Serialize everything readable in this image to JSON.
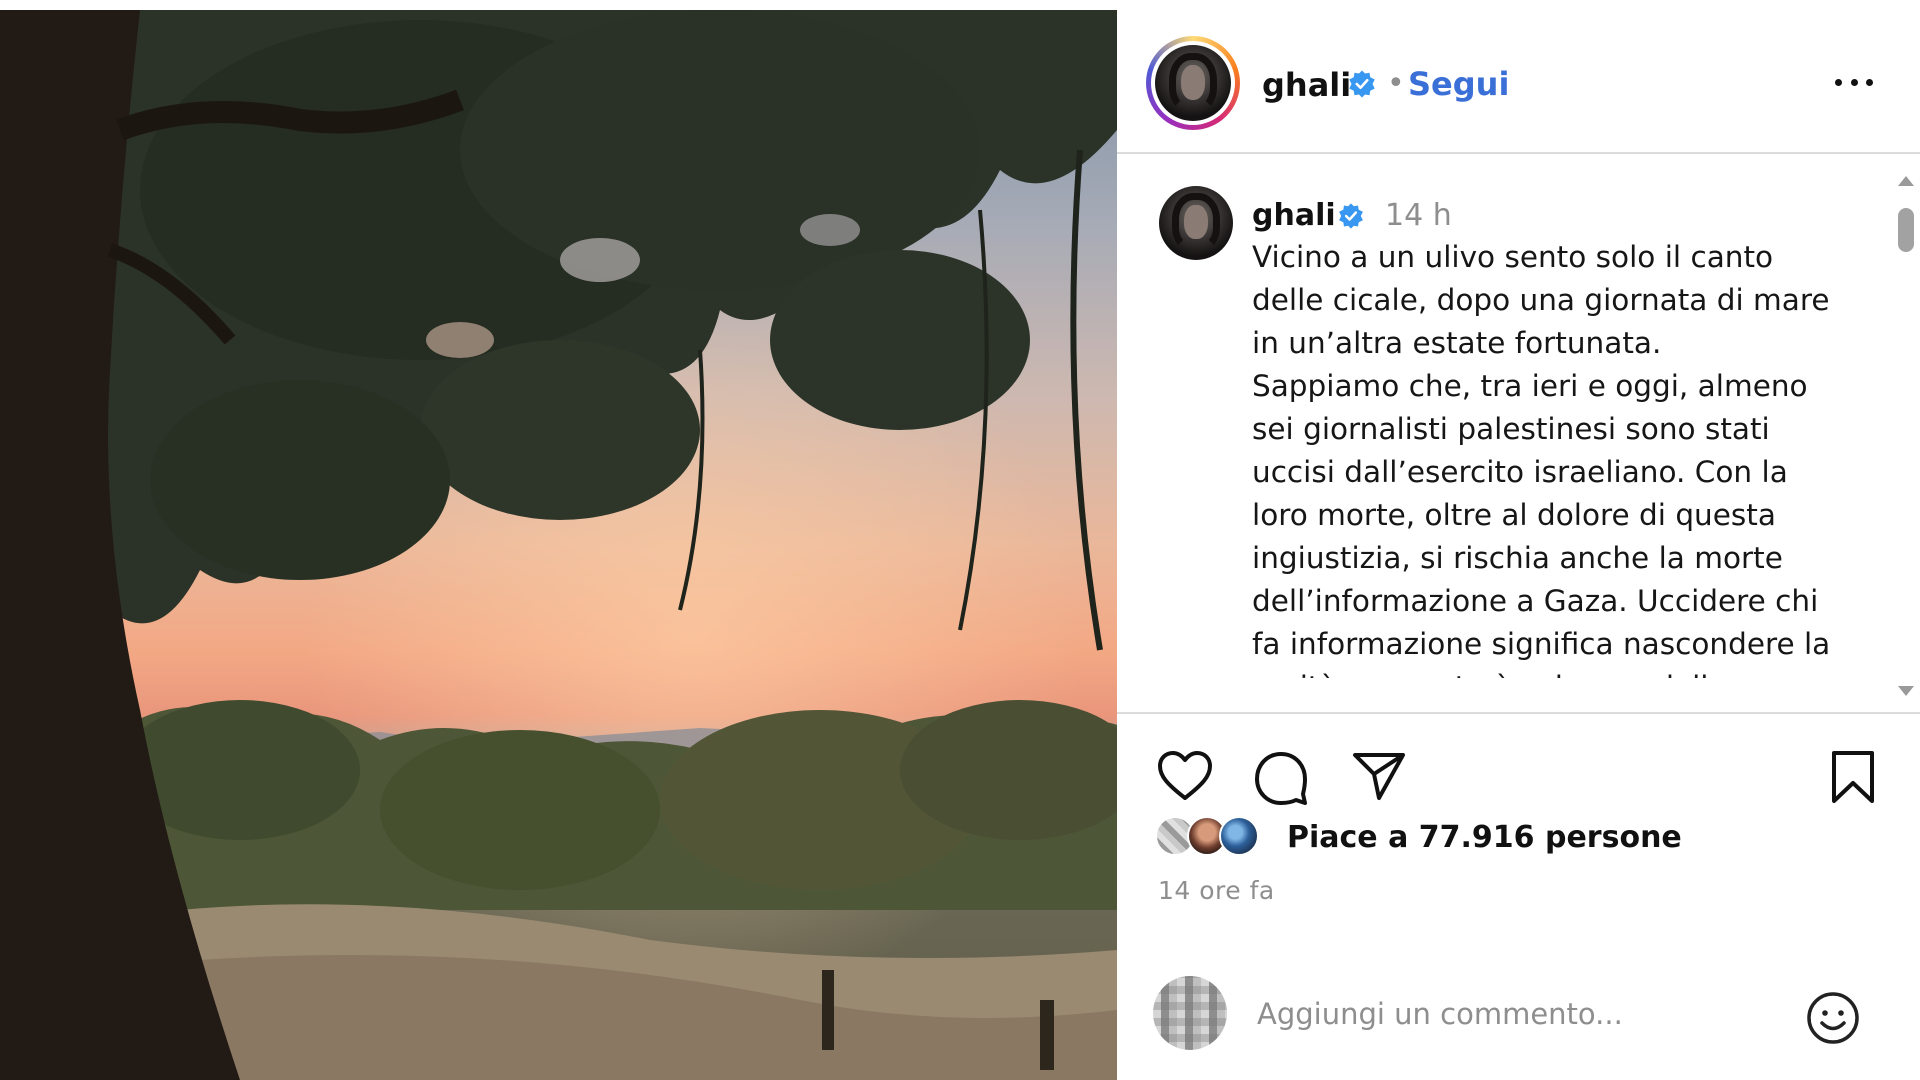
{
  "post": {
    "username": "ghali",
    "follow_label": "Segui",
    "separator": "•",
    "caption": {
      "username": "ghali",
      "time": "14 h",
      "text": "Vicino a un ulivo sento solo il canto delle cicale, dopo una giornata di mare in un’altra estate fortunata.\nSappiamo che, tra ieri e oggi, almeno sei giornalisti palestinesi sono stati uccisi dall’esercito israeliano. Con la loro morte, oltre al dolore di questa ingiustizia, si rischia anche la morte dell’informazione a Gaza. Uccidere chi fa informazione significa nascondere la verità, e questo è solo una delle"
    },
    "likes_text": "Piace a 77.916 persone",
    "age": "14 ore fa",
    "comment_placeholder": "Aggiungi un commento..."
  },
  "icons": {
    "verified": "verified-badge-icon",
    "more": "more-options-icon",
    "like": "heart-icon",
    "comment": "comment-bubble-icon",
    "share": "paper-plane-icon",
    "save": "bookmark-icon",
    "emoji": "smiley-icon"
  },
  "colors": {
    "verified_blue": "#3897f0",
    "link_blue": "#3a6fd8",
    "muted_text": "#8e8e8e",
    "divider": "#dbdbdb"
  }
}
